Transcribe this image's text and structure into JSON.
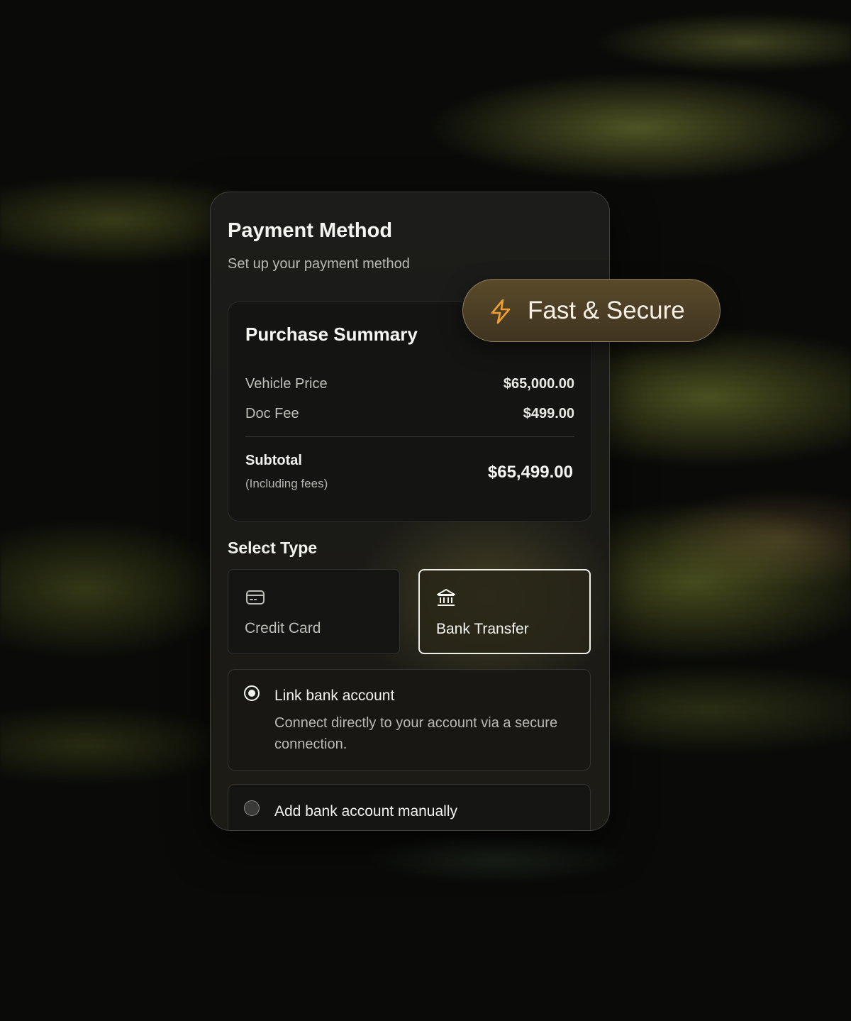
{
  "colors": {
    "accent": "#f0a030",
    "card_background": "#1c1c1a",
    "text_primary": "#f5f5f2",
    "text_secondary": "#b9b9b4"
  },
  "header": {
    "title": "Payment Method",
    "subtitle": "Set up your payment method"
  },
  "badge": {
    "icon": "lightning-bolt-icon",
    "label": "Fast & Secure"
  },
  "summary": {
    "title": "Purchase Summary",
    "rows": [
      {
        "label": "Vehicle Price",
        "value": "$65,000.00"
      },
      {
        "label": "Doc Fee",
        "value": "$499.00"
      }
    ],
    "subtotal": {
      "label": "Subtotal",
      "note": "(Including fees)",
      "value": "$65,499.00"
    }
  },
  "select_type": {
    "label": "Select Type",
    "options": [
      {
        "label": "Credit Card",
        "icon": "credit-card-icon",
        "selected": false
      },
      {
        "label": "Bank Transfer",
        "icon": "bank-icon",
        "selected": true
      }
    ]
  },
  "bank_options": [
    {
      "title": "Link bank account",
      "description": "Connect directly to your account via a secure connection.",
      "selected": true
    },
    {
      "title": "Add bank account manually",
      "selected": false
    }
  ]
}
